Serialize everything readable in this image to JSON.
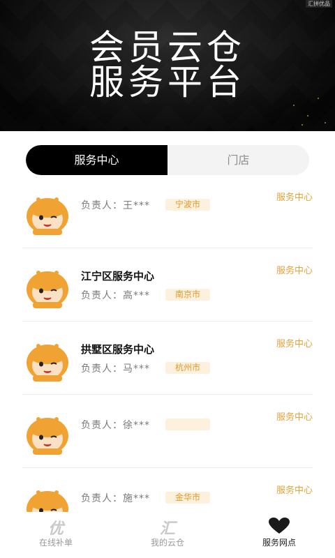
{
  "hero": {
    "title_line1": "会员云仓",
    "title_line2": "服务平台",
    "corner_text": "汇拼优品"
  },
  "tabs": [
    {
      "label": "服务中心",
      "active": true
    },
    {
      "label": "门店",
      "active": false
    }
  ],
  "items": [
    {
      "name": "",
      "person": "负责人：王***",
      "city": "宁波市",
      "type": "服务中心"
    },
    {
      "name": "江宁区服务中心",
      "person": "负责人：高***",
      "city": "南京市",
      "type": "服务中心"
    },
    {
      "name": "拱墅区服务中心",
      "person": "负责人：马***",
      "city": "杭州市",
      "type": "服务中心"
    },
    {
      "name": "",
      "person": "负责人：徐***",
      "city": "",
      "type": "服务中心"
    },
    {
      "name": "",
      "person": "负责人：施***",
      "city": "金华市",
      "type": "服务中心"
    }
  ],
  "bottom_nav": [
    {
      "label": "在线补单",
      "icon": "you-glyph-icon",
      "glyph": "优",
      "active": false
    },
    {
      "label": "我的云仓",
      "icon": "hui-glyph-icon",
      "glyph": "汇",
      "active": false
    },
    {
      "label": "服务网点",
      "icon": "heart-icon",
      "active": true
    }
  ],
  "colors": {
    "accent": "#e3a33b",
    "city_bg": "#fdf0dc",
    "active_tab": "#000000"
  }
}
